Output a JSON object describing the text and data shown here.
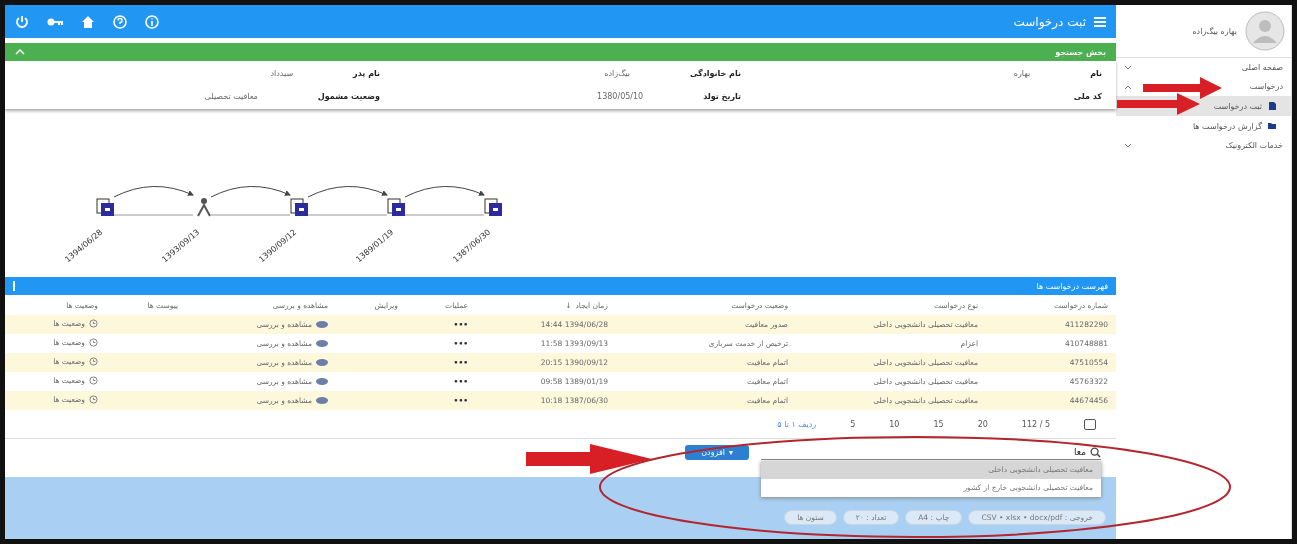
{
  "header": {
    "title": "ثبت درخواست"
  },
  "sidebar": {
    "user": "بهاره بیگ‌زاده",
    "items": [
      {
        "label": "صفحه اصلی",
        "expanded": false,
        "selected": false
      },
      {
        "label": "درخواست",
        "expanded": true,
        "selected": false,
        "children": [
          {
            "label": "ثبت درخواست",
            "selected": true,
            "kind": "doc"
          },
          {
            "label": "گزارش درخواست ها",
            "selected": false,
            "kind": "folder"
          }
        ]
      },
      {
        "label": "خدمات الکترونیک",
        "expanded": false,
        "selected": false
      }
    ]
  },
  "search_panel": {
    "title": "بخش جستجو",
    "expanded": true,
    "fields": [
      {
        "label": "نام",
        "value": "بهاره"
      },
      {
        "label": "نام خانوادگی",
        "value": "بیگ‌زاده"
      },
      {
        "label": "نام پدر",
        "value": "سیدداد"
      },
      {
        "label": "کد ملی"
      },
      {
        "label": "تاریخ تولد",
        "value": "1380/05/10"
      },
      {
        "label": "وضعیت مشمول",
        "value": "معافیت تحصیلی"
      }
    ]
  },
  "timeline": [
    {
      "kind": "doc",
      "date": "1394/06/28"
    },
    {
      "kind": "person",
      "date": "1393/09/13"
    },
    {
      "kind": "doc",
      "date": "1390/09/12"
    },
    {
      "kind": "doc",
      "date": "1389/01/19"
    },
    {
      "kind": "doc",
      "date": "1387/06/30"
    }
  ],
  "requests": {
    "title": "فهرست درخواست ها",
    "sort_mark": "↓",
    "columns": [
      "شماره درخواست",
      "نوع درخواست",
      "وضعیت درخواست",
      "زمان ایجاد",
      "عملیات",
      "ویرایش",
      "مشاهده و بررسی",
      "پیوست ها",
      "وضعیت ها"
    ],
    "rows": [
      {
        "number": "411282290",
        "type": "معافیت تحصیلی دانشجویی داخلی",
        "status": "صدور معافیت",
        "created": "1394/06/28 14:44",
        "actions": "•••",
        "view": "مشاهده و بررسی",
        "states": "وضعیت ها"
      },
      {
        "number": "410748881",
        "type": "اعزام",
        "status": "ترخیص از خدمت سربازی",
        "created": "1393/09/13 11:58",
        "actions": "•••",
        "view": "مشاهده و بررسی",
        "states": "وضعیت ها"
      },
      {
        "number": "47510554",
        "type": "معافیت تحصیلی دانشجویی داخلی",
        "status": "اتمام معافیت",
        "created": "1390/09/12 20:15",
        "actions": "•••",
        "view": "مشاهده و بررسی",
        "states": "وضعیت ها"
      },
      {
        "number": "45763322",
        "type": "معافیت تحصیلی دانشجویی داخلی",
        "status": "اتمام معافیت",
        "created": "1389/01/19 09:58",
        "actions": "•••",
        "view": "مشاهده و بررسی",
        "states": "وضعیت ها"
      },
      {
        "number": "44674456",
        "type": "معافیت تحصیلی دانشجویی داخلی",
        "status": "اتمام معافیت",
        "created": "1387/06/30 10:18",
        "actions": "•••",
        "view": "مشاهده و بررسی",
        "states": "وضعیت ها"
      }
    ],
    "pager": {
      "summary": "5 / 112",
      "sizes": [
        "20",
        "15",
        "10",
        "5"
      ],
      "info": "ردیف ۱ تا ۵"
    }
  },
  "add_request": {
    "search_value": "معا",
    "button": "افزودن",
    "caret": "▾",
    "suggestions": [
      {
        "label": "معافیت تحصیلی دانشجویی داخلی",
        "selected": true
      },
      {
        "label": "معافیت تحصیلی دانشجویی خارج از کشور",
        "selected": false
      }
    ]
  },
  "footer_chips": [
    "خروجی : CSV • xlsx • docx/pdf",
    "چاپ : A4",
    "تعداد : ۲۰",
    "ستون ها"
  ]
}
